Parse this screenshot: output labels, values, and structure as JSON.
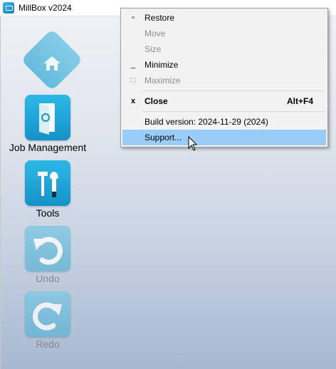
{
  "window": {
    "title": "MillBox v2024"
  },
  "toolbar": {
    "job_management": "Job Management",
    "tools": "Tools",
    "undo": "Undo",
    "redo": "Redo"
  },
  "context_menu": {
    "items": [
      {
        "label": "Restore",
        "glyph": "▫",
        "enabled": true
      },
      {
        "label": "Move",
        "glyph": "",
        "enabled": false
      },
      {
        "label": "Size",
        "glyph": "",
        "enabled": false
      },
      {
        "label": "Minimize",
        "glyph": "_",
        "enabled": true
      },
      {
        "label": "Maximize",
        "glyph": "□",
        "enabled": false
      },
      {
        "label": "Close",
        "glyph": "x",
        "accelerator": "Alt+F4",
        "enabled": true,
        "bold": true
      },
      {
        "label": "Build version: 2024-11-29 (2024)",
        "glyph": "",
        "enabled": true
      },
      {
        "label": "Support...",
        "glyph": "",
        "enabled": true,
        "highlighted": true
      }
    ]
  },
  "colors": {
    "accent": "#1592c8",
    "highlight": "#99ccf7"
  }
}
